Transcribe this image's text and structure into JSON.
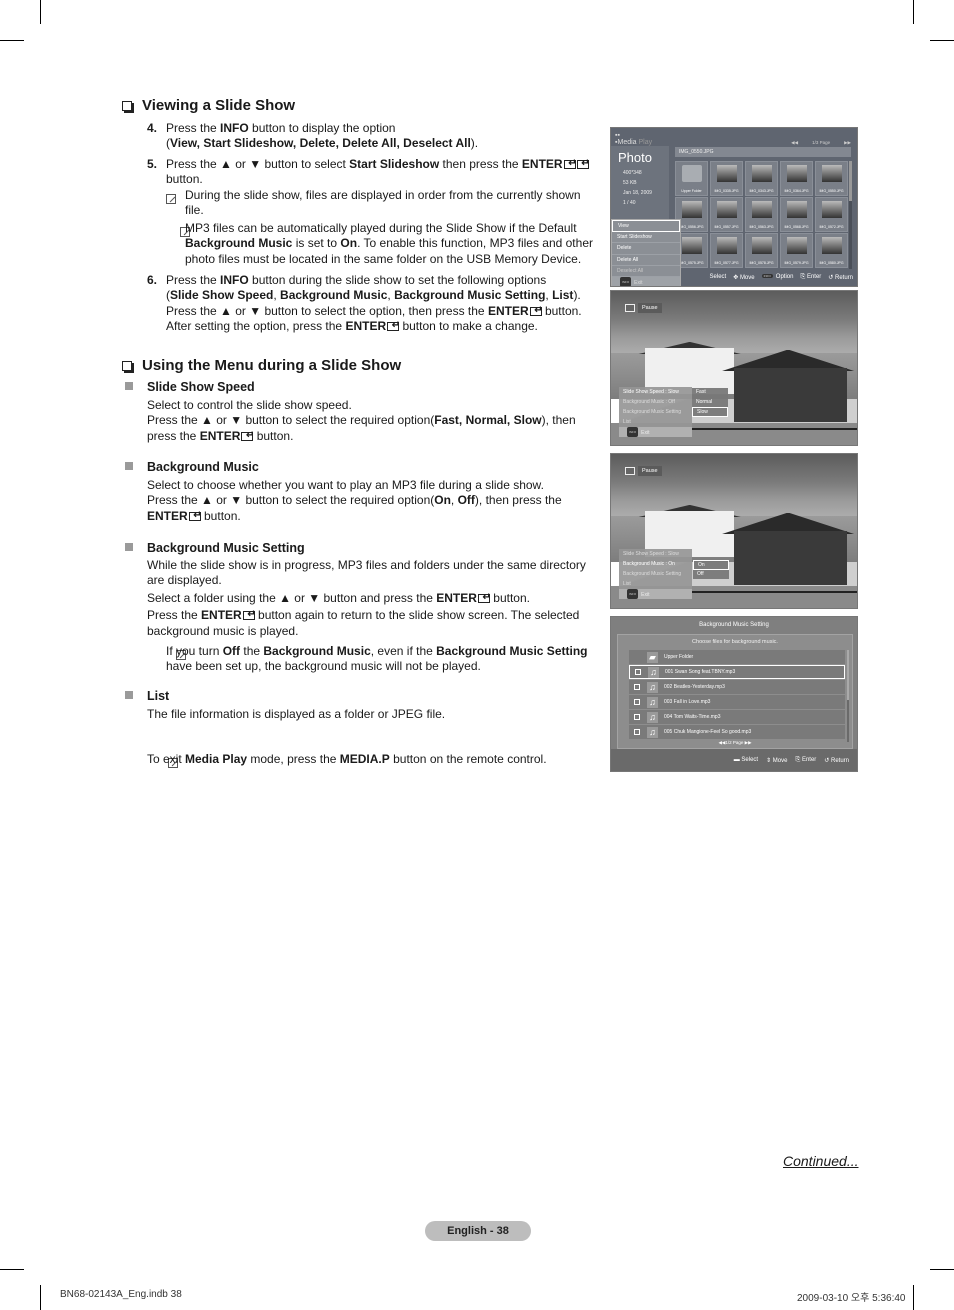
{
  "section1": {
    "heading": "Viewing a Slide Show",
    "steps": [
      {
        "num": "4.",
        "lines": [
          "Press the <b>INFO</b> button to display the option",
          "(<b>View, Start Slideshow, Delete, Delete All, Deselect All</b>)."
        ]
      },
      {
        "num": "5.",
        "lines": [
          "Press the ▲ or ▼ button to select <b>Start Slideshow</b> then press the <b>ENTER</b>",
          "button."
        ]
      },
      {
        "num": "6.",
        "lines": [
          "Press the <b>INFO</b> button during the slide show to set the following options",
          "(<b>Slide Show Speed</b>, <b>Background Music</b>, <b>Background Music Setting</b>, <b>List</b>).",
          "Press the ▲ or ▼ button to select the option, then press the <b>ENTER</b> button.",
          "After setting the option, press the <b>ENTER</b> button to make a change."
        ]
      }
    ],
    "notes": [
      [
        "During the slide show, files are displayed in order from the currently shown",
        "file."
      ],
      [
        "MP3 files can be automatically played during the Slide Show if the Default",
        "<b>Background Music</b> is set to <b>On</b>. To enable this function, MP3 files and other",
        "photo files must be located in the same folder on the USB Memory Device."
      ]
    ]
  },
  "section2": {
    "heading": "Using the Menu during a Slide Show",
    "items": [
      {
        "title": "Slide Show Speed",
        "lines": [
          "Select to control the slide show speed.",
          "Press the ▲ or ▼ button to select the required option(<b>Fast, Normal, Slow</b>), then",
          "press the <b>ENTER</b> button."
        ]
      },
      {
        "title": "Background Music",
        "lines": [
          "Select to choose whether you want to play an MP3 file during a slide show.",
          "Press the ▲ or ▼ button to select the required option(<b>On</b>, <b>Off</b>), then press the",
          "<b>ENTER</b> button."
        ]
      },
      {
        "title": "Background Music Setting",
        "lines": [
          "While the slide show is in progress, MP3 files and folders under the same directory",
          "are displayed.",
          "Select a folder using the ▲ or ▼ button and press the <b>ENTER</b> button.",
          "Press the <b>ENTER</b> button again to return to the slide show screen. The selected",
          "background music is played."
        ],
        "note": [
          "If you turn <b>Off</b> the <b>Background Music</b>, even if the <b>Background Music Setting</b>",
          "have been set up, the background music will not be played."
        ]
      },
      {
        "title": "List",
        "lines": [
          "The file information is displayed as a folder or JPEG file."
        ]
      }
    ],
    "exit_note": "To exit <b>Media Play</b> mode, press the <b>MEDIA.P</b> button on the remote control."
  },
  "screen1": {
    "logo_media": "Media",
    "logo_play": "Play",
    "pager": {
      "prev": "◀◀",
      "label": "1/3 Page",
      "next": "▶▶"
    },
    "title": "Photo",
    "meta": [
      "400*348",
      "53 KB",
      "Jan 18, 2009",
      "1 / 40"
    ],
    "current_file": "IMG_0550.JPG",
    "thumbs": [
      "Upper Folder",
      "IMG_0335.JPG",
      "IMG_0343.JPG",
      "IMG_0364.JPG",
      "IMG_0550.JPG",
      "IMG_0556.JPG",
      "IMG_0557.JPG",
      "IMG_0563.JPG",
      "IMG_0568.JPG",
      "IMG_0572.JPG",
      "IMG_0575.JPG",
      "IMG_0577.JPG",
      "IMG_0578.JPG",
      "IMG_0579.JPG",
      "IMG_0580.JPG"
    ],
    "menu": [
      "View",
      "Start Slideshow",
      "Delete",
      "Delete All",
      "Deselect All"
    ],
    "menu_exit": "Exit",
    "info_chip": "INFO",
    "hints": [
      "Select",
      "Move",
      "Option",
      "Enter",
      "Return"
    ]
  },
  "screen2": {
    "pause": "Pause",
    "menu": [
      "Slide Show Speed : Slow",
      "Background Music : Off",
      "Background Music Setting",
      "List"
    ],
    "exit": "Exit",
    "options": [
      "Fast",
      "Normal",
      "Slow"
    ],
    "selected_option": "Slow"
  },
  "screen3": {
    "pause": "Pause",
    "menu": [
      "Slide Show Speed : Slow",
      "Background Music : On",
      "Background Music Setting",
      "List"
    ],
    "exit": "Exit",
    "options": [
      "On",
      "Off"
    ],
    "selected_option": "On"
  },
  "screen4": {
    "title": "Background Music Setting",
    "subtitle": "Choose files for background music.",
    "rows": [
      "Upper Folder",
      "001 Swan Song feat.TBNY.mp3",
      "002 Beatles-Yesterday.mp3",
      "003 Fall in Love.mp3",
      "004 Tom Waits-Time.mp3",
      "005 Chuk Mangione-Feel So good.mp3"
    ],
    "pager": "◀◀1/2 Page ▶▶",
    "hints": [
      "Select",
      "Move",
      "Enter",
      "Return"
    ]
  },
  "continued": "Continued...",
  "page_label": "English - 38",
  "footer_left": "BN68-02143A_Eng.indb   38",
  "footer_right": "2009-03-10   오후 5:36:40"
}
